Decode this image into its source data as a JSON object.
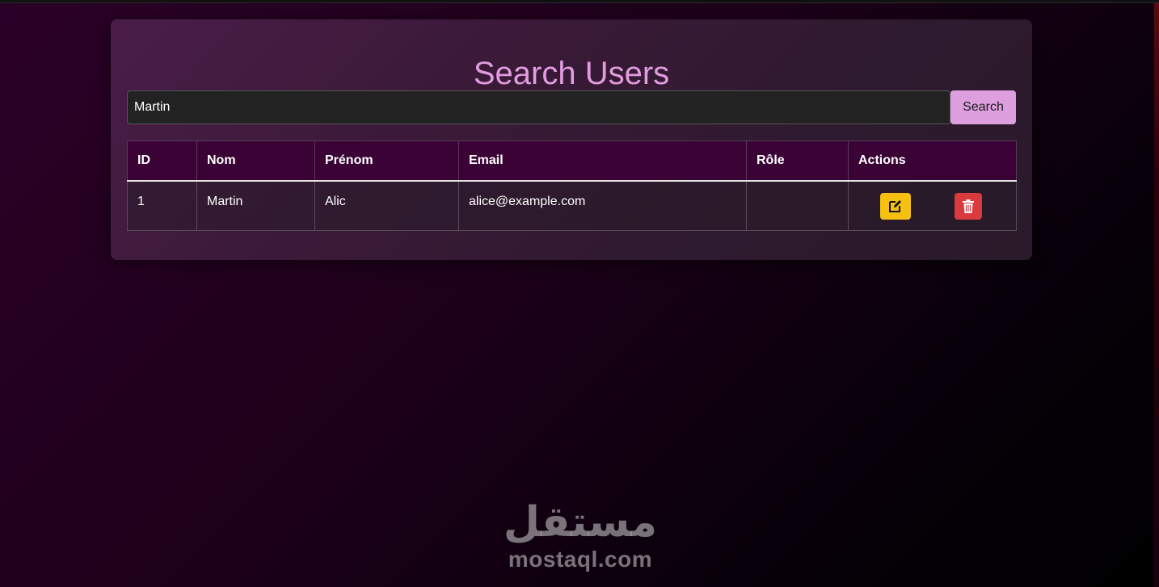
{
  "page": {
    "title": "Search Users"
  },
  "search": {
    "value": "Martin",
    "button_label": "Search"
  },
  "table": {
    "headers": [
      "ID",
      "Nom",
      "Prénom",
      "Email",
      "Rôle",
      "Actions"
    ],
    "rows": [
      {
        "id": "1",
        "nom": "Martin",
        "prenom": "Alic",
        "email": "alice@example.com",
        "role": "",
        "actions": [
          "edit-icon",
          "trash-icon"
        ]
      }
    ]
  },
  "watermark": {
    "logo": "مستقل",
    "url": "mostaql.com"
  },
  "colors": {
    "accent": "#dd9fdd",
    "title": "#e39be0",
    "edit": "#f5c010",
    "delete": "#d83a3e",
    "header_bg": "#3a0235"
  }
}
